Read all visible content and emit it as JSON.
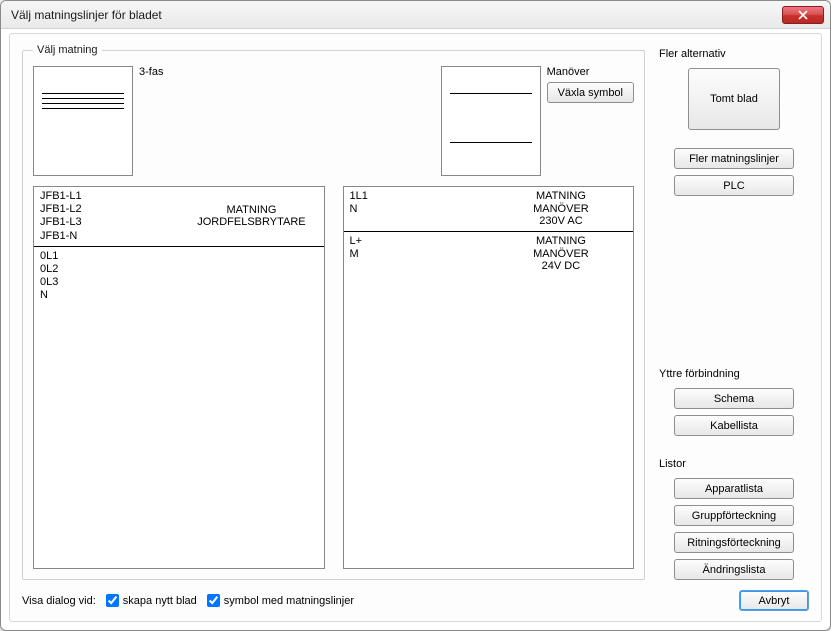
{
  "window": {
    "title": "Välj matningslinjer för bladet"
  },
  "group": {
    "legend": "Välj matning",
    "preview3fas_label": "3-fas",
    "previewman_label": "Manöver",
    "switch_symbol_label": "Växla symbol"
  },
  "leftlist": [
    {
      "lines": [
        "JFB1-L1",
        "JFB1-L2",
        "JFB1-L3",
        "JFB1-N"
      ],
      "desc": [
        "MATNING",
        "JORDFELSBRYTARE"
      ]
    },
    {
      "lines": [
        "0L1",
        "0L2",
        "0L3",
        "N"
      ],
      "desc": []
    }
  ],
  "rightlist": [
    {
      "lines": [
        "1L1",
        "N"
      ],
      "desc": [
        "MATNING",
        "MANÖVER",
        "230V AC"
      ]
    },
    {
      "lines": [
        "L+",
        "M"
      ],
      "desc": [
        "MATNING",
        "MANÖVER",
        "24V DC"
      ]
    }
  ],
  "right": {
    "fler_alt_header": "Fler alternativ",
    "tomt_blad": "Tomt blad",
    "fler_matningslinjer": "Fler matningslinjer",
    "plc": "PLC",
    "yttre_header": "Yttre förbindning",
    "schema": "Schema",
    "kabellista": "Kabellista",
    "listor_header": "Listor",
    "apparatlista": "Apparatlista",
    "gruppforteckning": "Gruppförteckning",
    "ritningsforteckning": "Ritningsförteckning",
    "andringslista": "Ändringslista"
  },
  "bottom": {
    "visa_dialog_vid": "Visa dialog vid:",
    "chk_new_sheet": "skapa nytt blad",
    "chk_symbol": "symbol med matningslinjer",
    "avbryt": "Avbryt"
  },
  "checks": {
    "new_sheet": true,
    "symbol": true
  }
}
